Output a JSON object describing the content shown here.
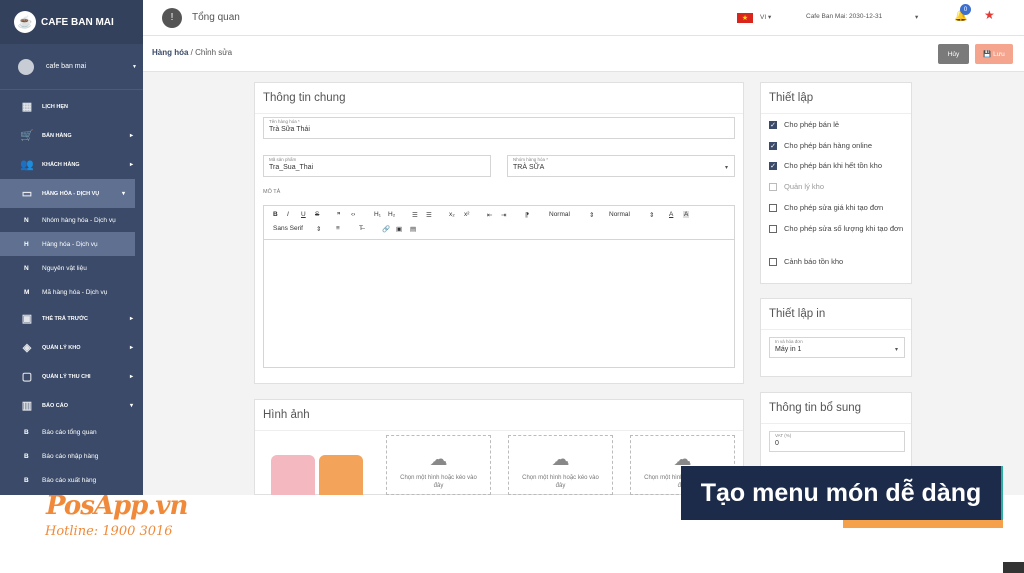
{
  "brand": {
    "name": "CAFE BAN MAI"
  },
  "user": {
    "name": "cafe ban mai"
  },
  "menu": [
    {
      "label": "LỊCH HẸN",
      "icon": "calendar-icon",
      "glyph": "▦"
    },
    {
      "label": "BÁN HÀNG",
      "icon": "cart-icon",
      "glyph": "🛒",
      "arrow": "▸"
    },
    {
      "label": "KHÁCH HÀNG",
      "icon": "users-icon",
      "glyph": "👥",
      "arrow": "▸"
    },
    {
      "label": "HÀNG HÓA - DỊCH VỤ",
      "icon": "box-icon",
      "glyph": "▭",
      "arrow": "▾"
    },
    {
      "label": "THẺ TRẢ TRƯỚC",
      "icon": "card-icon",
      "glyph": "▣",
      "arrow": "▸"
    },
    {
      "label": "QUẢN LÝ KHO",
      "icon": "warehouse-icon",
      "glyph": "◈",
      "arrow": "▸"
    },
    {
      "label": "QUẢN LÝ THU CHI",
      "icon": "money-icon",
      "glyph": "▢",
      "arrow": "▸"
    },
    {
      "label": "BÁO CÁO",
      "icon": "chart-icon",
      "glyph": "▥",
      "arrow": "▾"
    }
  ],
  "submenu_goods": [
    {
      "letter": "N",
      "label": "Nhóm hàng hóa - Dịch vụ"
    },
    {
      "letter": "H",
      "label": "Hàng hóa - Dịch vụ"
    },
    {
      "letter": "N",
      "label": "Nguyên vật liệu"
    },
    {
      "letter": "M",
      "label": "Mã hàng hóa - Dịch vụ"
    }
  ],
  "submenu_reports": [
    {
      "letter": "B",
      "label": "Báo cáo tổng quan"
    },
    {
      "letter": "B",
      "label": "Báo cáo nhập hàng"
    },
    {
      "letter": "B",
      "label": "Báo cáo xuất hàng"
    }
  ],
  "topbar": {
    "info_glyph": "!",
    "title": "Tổng quan",
    "flag": "★",
    "lang": "VI ▾",
    "store": "Cafe Ban Mai: 2030-12-31",
    "store_caret": "▾",
    "bell": "🔔",
    "notif_count": "0",
    "star": "★"
  },
  "breadcrumb": {
    "first": "Hàng hóa",
    "sep": " / ",
    "second": "Chỉnh sửa"
  },
  "actions": {
    "cancel": "Hủy",
    "save": "💾 Lưu"
  },
  "general": {
    "title": "Thông tin chung",
    "name_label": "Tên hàng hóa *",
    "name_value": "Trà Sữa Thái",
    "code_label": "Mã sản phẩm",
    "code_value": "Tra_Sua_Thai",
    "group_label": "Nhóm hàng hóa *",
    "group_value": "TRÀ SỮA",
    "group_caret": "▾",
    "desc_label": "MÔ TẢ"
  },
  "toolbar": {
    "bold": "B",
    "italic": "I",
    "underline": "U",
    "strike": "S",
    "quote": "❞",
    "code": "‹›",
    "h1": "H₁",
    "h2": "H₂",
    "ol": "☰",
    "ul": "☰",
    "sub": "x₂",
    "sup": "x²",
    "outdent": "⇤",
    "indent": "⇥",
    "rtl": "⁋",
    "size1": "Normal",
    "size1_caret": "⇕",
    "size2": "Normal",
    "size2_caret": "⇕",
    "color": "A",
    "bg": "A",
    "font": "Sans Serif",
    "font_caret": "⇕",
    "align": "≡",
    "clean": "T̶",
    "link": "🔗",
    "image": "▣",
    "video": "▤"
  },
  "settings": {
    "title": "Thiết lập",
    "items": [
      {
        "label": "Cho phép bán lẻ",
        "checked": true,
        "disabled": false
      },
      {
        "label": "Cho phép bán hàng online",
        "checked": true,
        "disabled": false
      },
      {
        "label": "Cho phép bán khi hết tồn kho",
        "checked": true,
        "disabled": false
      },
      {
        "label": "Quản lý kho",
        "checked": false,
        "disabled": true
      },
      {
        "label": "Cho phép sửa giá khi tạo đơn",
        "checked": false,
        "disabled": false
      },
      {
        "label": "Cho phép sửa số lượng khi tạo đơn",
        "checked": false,
        "disabled": false
      },
      {
        "label": "Cảnh báo tồn kho",
        "checked": false,
        "disabled": false
      }
    ],
    "check_glyph": "✓"
  },
  "print": {
    "title": "Thiết lập in",
    "label": "In và hóa đơn",
    "value": "Máy in 1",
    "caret": "▾"
  },
  "extra": {
    "title": "Thông tin bổ sung",
    "vat_label": "VAT (%)",
    "vat_value": "0"
  },
  "images": {
    "title": "Hình ảnh",
    "upload_text": "Chọn một hình hoặc kéo vào đây",
    "cloud": "☁"
  },
  "promo": {
    "logo": "PosApp.vn",
    "hotline": "Hotline: 1900 3016",
    "banner": "Tạo menu món dễ dàng"
  },
  "colors": {
    "sidebar": "#3a4a68",
    "accent_orange": "#f08a3a",
    "save_button": "#f5a48e",
    "banner_bg": "#1d2b4a",
    "cup_pink": "#f3b8c0",
    "cup_orange": "#f3a35a"
  }
}
